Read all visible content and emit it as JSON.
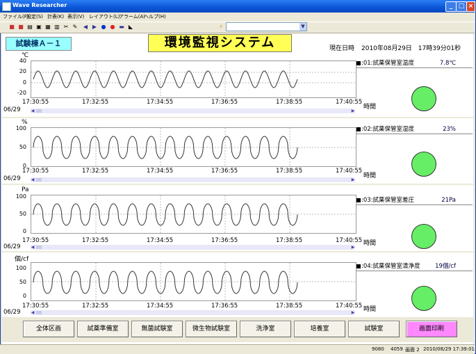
{
  "window": {
    "title": "Wave Researcher"
  },
  "menu": [
    "ファイル(F)",
    "設定(S)",
    "計表(K)",
    "表示(V)",
    "レイアウト(L)",
    "アラーム(A)",
    "ヘルプ(H)"
  ],
  "building": "試験棟Ａ－１",
  "app_title": "環境監視システム",
  "datetime": {
    "label": "現在日時",
    "value": "2010年08月29日　17時39分01秒"
  },
  "axis": {
    "date": "06/29",
    "time_label": "時間",
    "x_ticks": [
      "17:30:55",
      "17:32:55",
      "17:34:55",
      "17:36:55",
      "17:38:55",
      "17:40:55"
    ]
  },
  "panels": [
    {
      "unit": "℃",
      "yticks": [
        "40",
        "20",
        "0",
        "-20"
      ],
      "sensor_label": ":01:試薬保管室温度",
      "value": "7.8℃",
      "status_color": "#66ee66"
    },
    {
      "unit": "%",
      "yticks": [
        "100",
        "50",
        "0"
      ],
      "sensor_label": ":02:試薬保管室湿度",
      "value": "23%",
      "status_color": "#66ee66"
    },
    {
      "unit": "Pa",
      "yticks": [
        "100",
        "50",
        "0"
      ],
      "sensor_label": ":03:試薬保管室差圧",
      "value": "21Pa",
      "status_color": "#66ee66"
    },
    {
      "unit": "個/cf",
      "yticks": [
        "100",
        "50",
        "0"
      ],
      "sensor_label": ":04:試薬保管室清浄度",
      "value": "19個/cf",
      "status_color": "#66ee66"
    }
  ],
  "nav_buttons": [
    "全体区画",
    "試薬準備室",
    "無菌試験室",
    "微生物試験室",
    "洗浄室",
    "培養室",
    "試験室",
    "画面印刷"
  ],
  "status": {
    "left": "9080",
    "mid": "4059",
    "screen": "画面 2",
    "time": "2010/08/29 17:39:01"
  }
}
